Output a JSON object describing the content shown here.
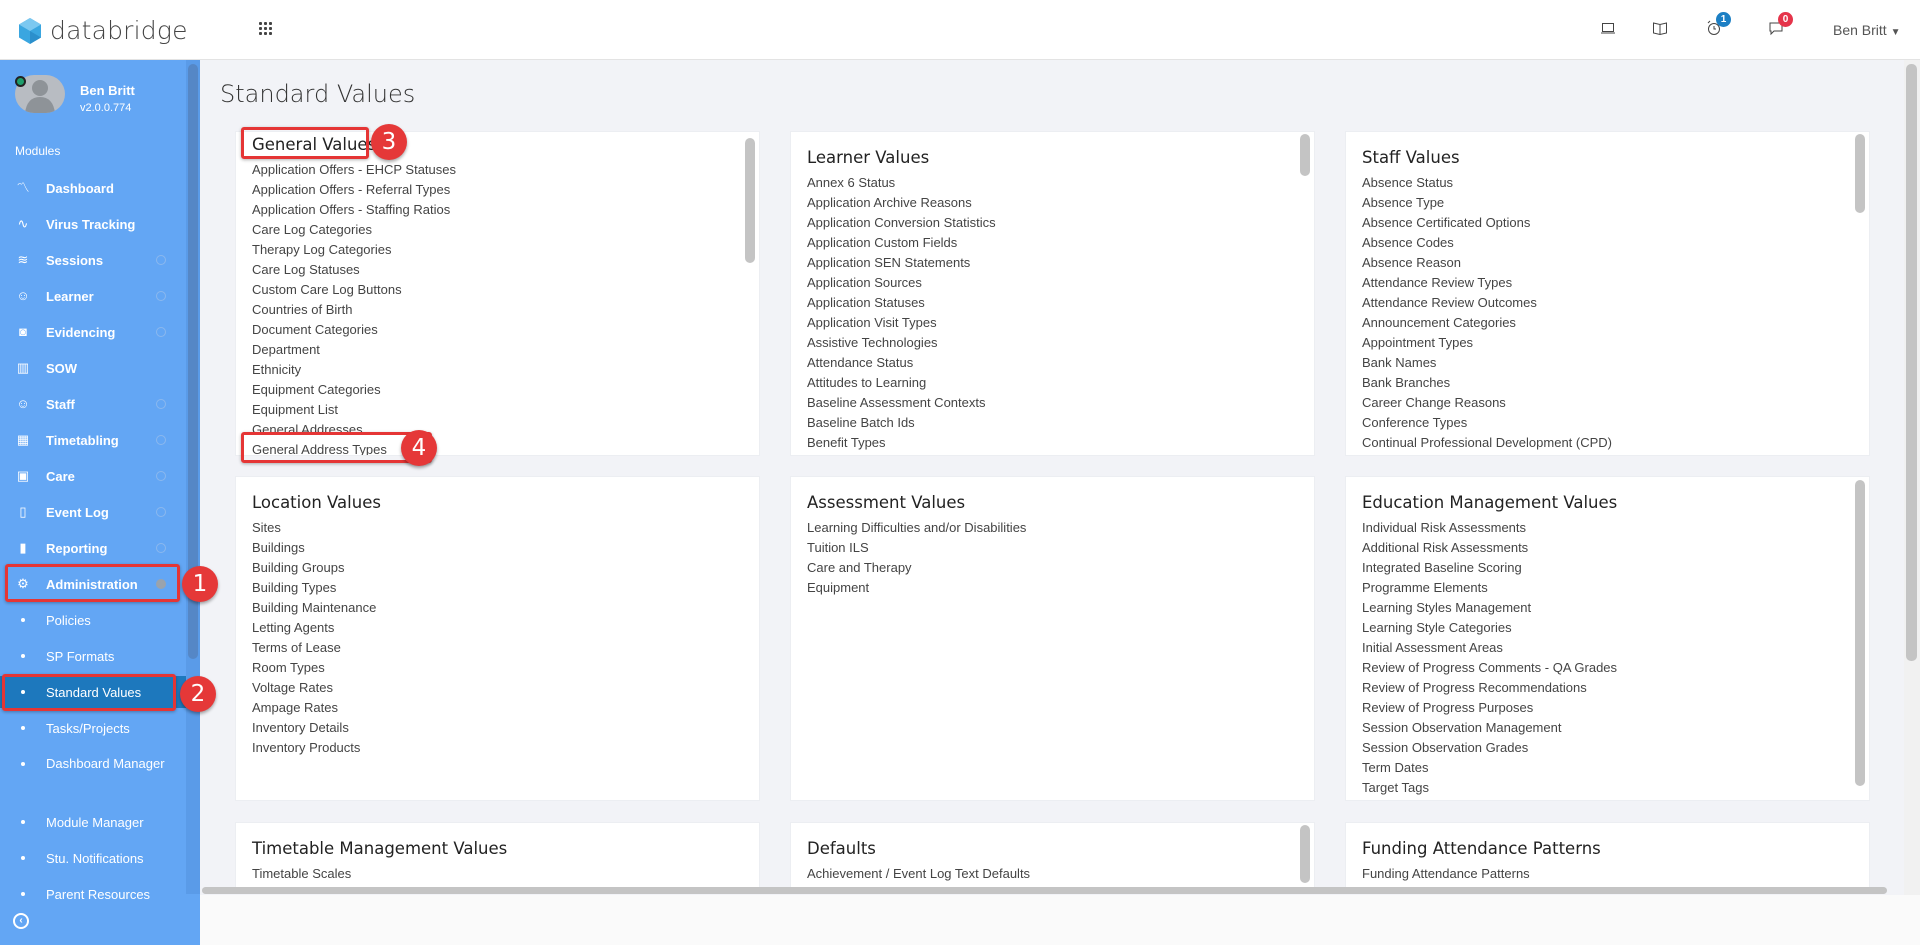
{
  "header": {
    "app_name": "databridge",
    "user_menu": "Ben Britt",
    "reminders_badge": "1",
    "messages_badge": "0",
    "icons": [
      "laptop-icon",
      "book-icon",
      "alarm-clock-icon",
      "chat-icon"
    ],
    "brand_color": "#63a6f4"
  },
  "sidebar": {
    "user_name": "Ben Britt",
    "version": "v2.0.0.774",
    "section_label": "Modules",
    "items": [
      {
        "label": "Dashboard",
        "icon": "chart-line-icon"
      },
      {
        "label": "Virus Tracking",
        "icon": "pulse-icon"
      },
      {
        "label": "Sessions",
        "icon": "layers-icon"
      },
      {
        "label": "Learner",
        "icon": "users-icon"
      },
      {
        "label": "Evidencing",
        "icon": "camera-icon"
      },
      {
        "label": "SOW",
        "icon": "book-icon"
      },
      {
        "label": "Staff",
        "icon": "users-icon"
      },
      {
        "label": "Timetabling",
        "icon": "calendar-icon"
      },
      {
        "label": "Care",
        "icon": "monitor-icon"
      },
      {
        "label": "Event Log",
        "icon": "clipboard-icon"
      },
      {
        "label": "Reporting",
        "icon": "bar-chart-icon"
      },
      {
        "label": "Administration",
        "icon": "gear-icon"
      }
    ],
    "sub_items": [
      "Policies",
      "SP Formats",
      "Standard Values",
      "Tasks/Projects",
      "Dashboard Manager",
      "Module Manager",
      "Stu. Notifications",
      "Parent Resources"
    ],
    "active": "Standard Values"
  },
  "page": {
    "title": "Standard Values"
  },
  "cards": [
    {
      "title": "General Values",
      "items": [
        "Application Offers - EHCP Statuses",
        "Application Offers - Referral Types",
        "Application Offers - Staffing Ratios",
        "Care Log Categories",
        "Therapy Log Categories",
        "Care Log Statuses",
        "Custom Care Log Buttons",
        "Countries of Birth",
        "Document Categories",
        "Department",
        "Ethnicity",
        "Equipment Categories",
        "Equipment List",
        "General Addresses",
        "General Address Types"
      ]
    },
    {
      "title": "Learner Values",
      "items": [
        "Annex 6 Status",
        "Application Archive Reasons",
        "Application Conversion Statistics",
        "Application Custom Fields",
        "Application SEN Statements",
        "Application Sources",
        "Application Statuses",
        "Application Visit Types",
        "Assistive Technologies",
        "Attendance Status",
        "Attitudes to Learning",
        "Baseline Assessment Contexts",
        "Baseline Batch Ids",
        "Benefit Types"
      ]
    },
    {
      "title": "Staff Values",
      "items": [
        "Absence Status",
        "Absence Type",
        "Absence Certificated Options",
        "Absence Codes",
        "Absence Reason",
        "Attendance Review Types",
        "Attendance Review Outcomes",
        "Announcement Categories",
        "Appointment Types",
        "Bank Names",
        "Bank Branches",
        "Career Change Reasons",
        "Conference Types",
        "Continual Professional Development (CPD)"
      ]
    },
    {
      "title": "Location Values",
      "items": [
        "Sites",
        "Buildings",
        "Building Groups",
        "Building Types",
        "Building Maintenance",
        "Letting Agents",
        "Terms of Lease",
        "Room Types",
        "Voltage Rates",
        "Ampage Rates",
        "Inventory Details",
        "Inventory Products"
      ]
    },
    {
      "title": "Assessment Values",
      "items": [
        "Learning Difficulties and/or Disabilities",
        "Tuition ILS",
        "Care and Therapy",
        "Equipment"
      ]
    },
    {
      "title": "Education Management Values",
      "items": [
        "Individual Risk Assessments",
        "Additional Risk Assessments",
        "Integrated Baseline Scoring",
        "Programme Elements",
        "Learning Styles Management",
        "Learning Style Categories",
        "Initial Assessment Areas",
        "Review of Progress Comments - QA Grades",
        "Review of Progress Recommendations",
        "Review of Progress Purposes",
        "Session Observation Management",
        "Session Observation Grades",
        "Term Dates",
        "Target Tags"
      ]
    },
    {
      "title": "Timetable Management Values",
      "items": [
        "Timetable Scales"
      ]
    },
    {
      "title": "Defaults",
      "items": [
        "Achievement / Event Log Text Defaults"
      ]
    },
    {
      "title": "Funding Attendance Patterns",
      "items": [
        "Funding Attendance Patterns"
      ]
    }
  ],
  "annotations": [
    "1",
    "2",
    "3",
    "4"
  ],
  "annotation_color": "#e53535"
}
